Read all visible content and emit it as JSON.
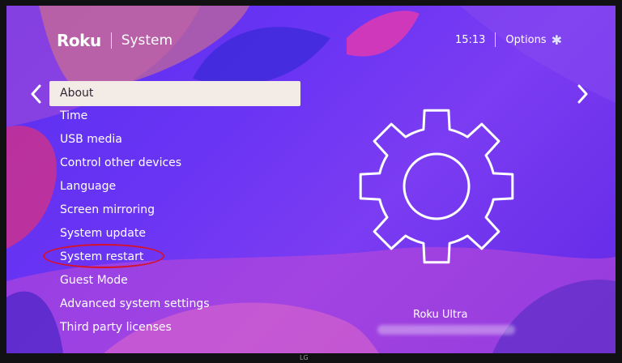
{
  "header": {
    "brand": "Roku",
    "title": "System"
  },
  "topbar": {
    "time": "15:13",
    "options_label": "Options"
  },
  "menu": {
    "items": [
      {
        "label": "About"
      },
      {
        "label": "Time"
      },
      {
        "label": "USB media"
      },
      {
        "label": "Control other devices"
      },
      {
        "label": "Language"
      },
      {
        "label": "Screen mirroring"
      },
      {
        "label": "System update"
      },
      {
        "label": "System restart"
      },
      {
        "label": "Guest Mode"
      },
      {
        "label": "Advanced system settings"
      },
      {
        "label": "Third party licenses"
      }
    ],
    "selected": "About",
    "highlighted": "System restart"
  },
  "device": {
    "name": "Roku Ultra"
  },
  "tv": {
    "brand": "LG"
  },
  "colors": {
    "background": "#6a34f4",
    "selection": "#f3ece6",
    "highlight_circle": "#d5122b"
  },
  "icons": {
    "left": "chevron-left-icon",
    "right": "chevron-right-icon",
    "options": "asterisk-icon",
    "hero": "gear-icon"
  }
}
